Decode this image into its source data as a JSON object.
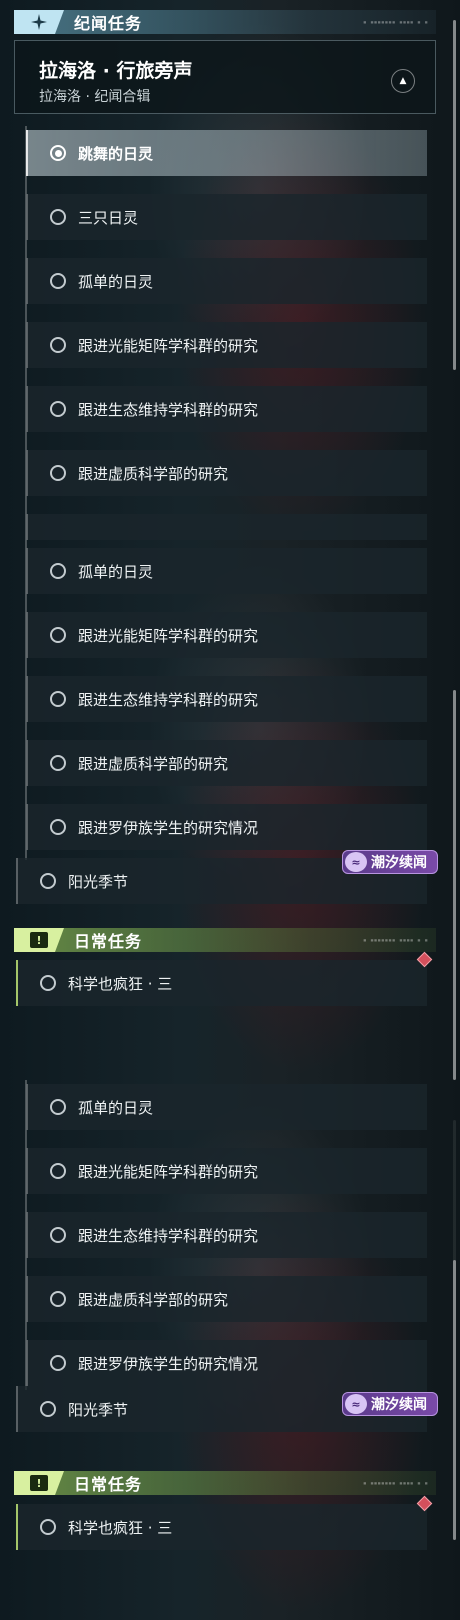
{
  "colors": {
    "story_accent": "#bfe4f2",
    "daily_accent": "#d8f0a0",
    "chaoxi_purple": "#7a4aa8",
    "marker_red": "#d4505c"
  },
  "header_deco": "▪ ▪▪▪▪▪▪▪ ▪▪▪▪ ▪ ▪",
  "story_header": {
    "title": "纪闻任务",
    "icon": "sparkle-icon"
  },
  "story_group": {
    "title": "拉海洛 · 行旅旁声",
    "subtitle": "拉海洛 · 纪闻合辑",
    "collapse_icon": "chevron-up-icon"
  },
  "panel1_quests": [
    {
      "label": "跳舞的日灵",
      "selected": true
    },
    {
      "label": "三只日灵"
    },
    {
      "label": "孤单的日灵"
    },
    {
      "label": "跟进光能矩阵学科群的研究"
    },
    {
      "label": "跟进生态维持学科群的研究"
    },
    {
      "label": "跟进虚质科学部的研究"
    }
  ],
  "scrolled_quests": [
    {
      "label": "孤单的日灵"
    },
    {
      "label": "跟进光能矩阵学科群的研究"
    },
    {
      "label": "跟进生态维持学科群的研究"
    },
    {
      "label": "跟进虚质科学部的研究"
    },
    {
      "label": "跟进罗伊族学生的研究情况"
    }
  ],
  "chaoxi_quest": {
    "label": "阳光季节",
    "badge": "潮汐续闻",
    "badge_icon": "wave-icon"
  },
  "daily_header": {
    "title": "日常任务",
    "badge": "!"
  },
  "daily_quest": {
    "label": "科学也疯狂 · 三",
    "marker_icon": "red-diamond-icon"
  }
}
